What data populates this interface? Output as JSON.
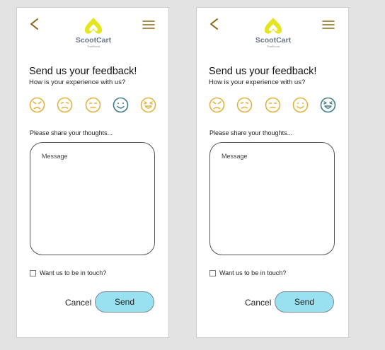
{
  "colors": {
    "page_background": "#e3e3e3",
    "accent_brown": "#8b6914",
    "logo_yellow": "#e6e620",
    "face_yellow": "#e3b23c",
    "face_teal": "#3d7d8c",
    "send_button": "#99e0f0"
  },
  "screens": [
    {
      "header": {
        "back_icon": "chevron-left-icon",
        "menu_icon": "hamburger-menu-icon",
        "logo": {
          "name": "ScootCart",
          "tagline": "ThatScoot"
        }
      },
      "title": "Send us your feedback!",
      "subtitle": "How is your experience with us?",
      "ratings": [
        {
          "icon": "angry-face-icon",
          "selected": false
        },
        {
          "icon": "sad-face-icon",
          "selected": false
        },
        {
          "icon": "neutral-face-icon",
          "selected": false
        },
        {
          "icon": "happy-face-icon",
          "selected": true
        },
        {
          "icon": "very-happy-face-icon",
          "selected": false
        }
      ],
      "thoughts_label": "Please share your thoughts...",
      "message_placeholder": "Message",
      "touch_label": "Want us to be in touch?",
      "cancel_label": "Cancel",
      "send_label": "Send"
    },
    {
      "header": {
        "back_icon": "chevron-left-icon",
        "menu_icon": "hamburger-menu-icon",
        "logo": {
          "name": "ScootCart",
          "tagline": "ThatScoot"
        }
      },
      "title": "Send us your feedback!",
      "subtitle": "How is your experience with us?",
      "ratings": [
        {
          "icon": "angry-face-icon",
          "selected": false
        },
        {
          "icon": "sad-face-icon",
          "selected": false
        },
        {
          "icon": "neutral-face-icon",
          "selected": false
        },
        {
          "icon": "happy-face-icon",
          "selected": false
        },
        {
          "icon": "very-happy-face-icon",
          "selected": true
        }
      ],
      "thoughts_label": "Please share your thoughts...",
      "message_placeholder": "Message",
      "touch_label": "Want us to be in touch?",
      "cancel_label": "Cancel",
      "send_label": "Send"
    }
  ]
}
